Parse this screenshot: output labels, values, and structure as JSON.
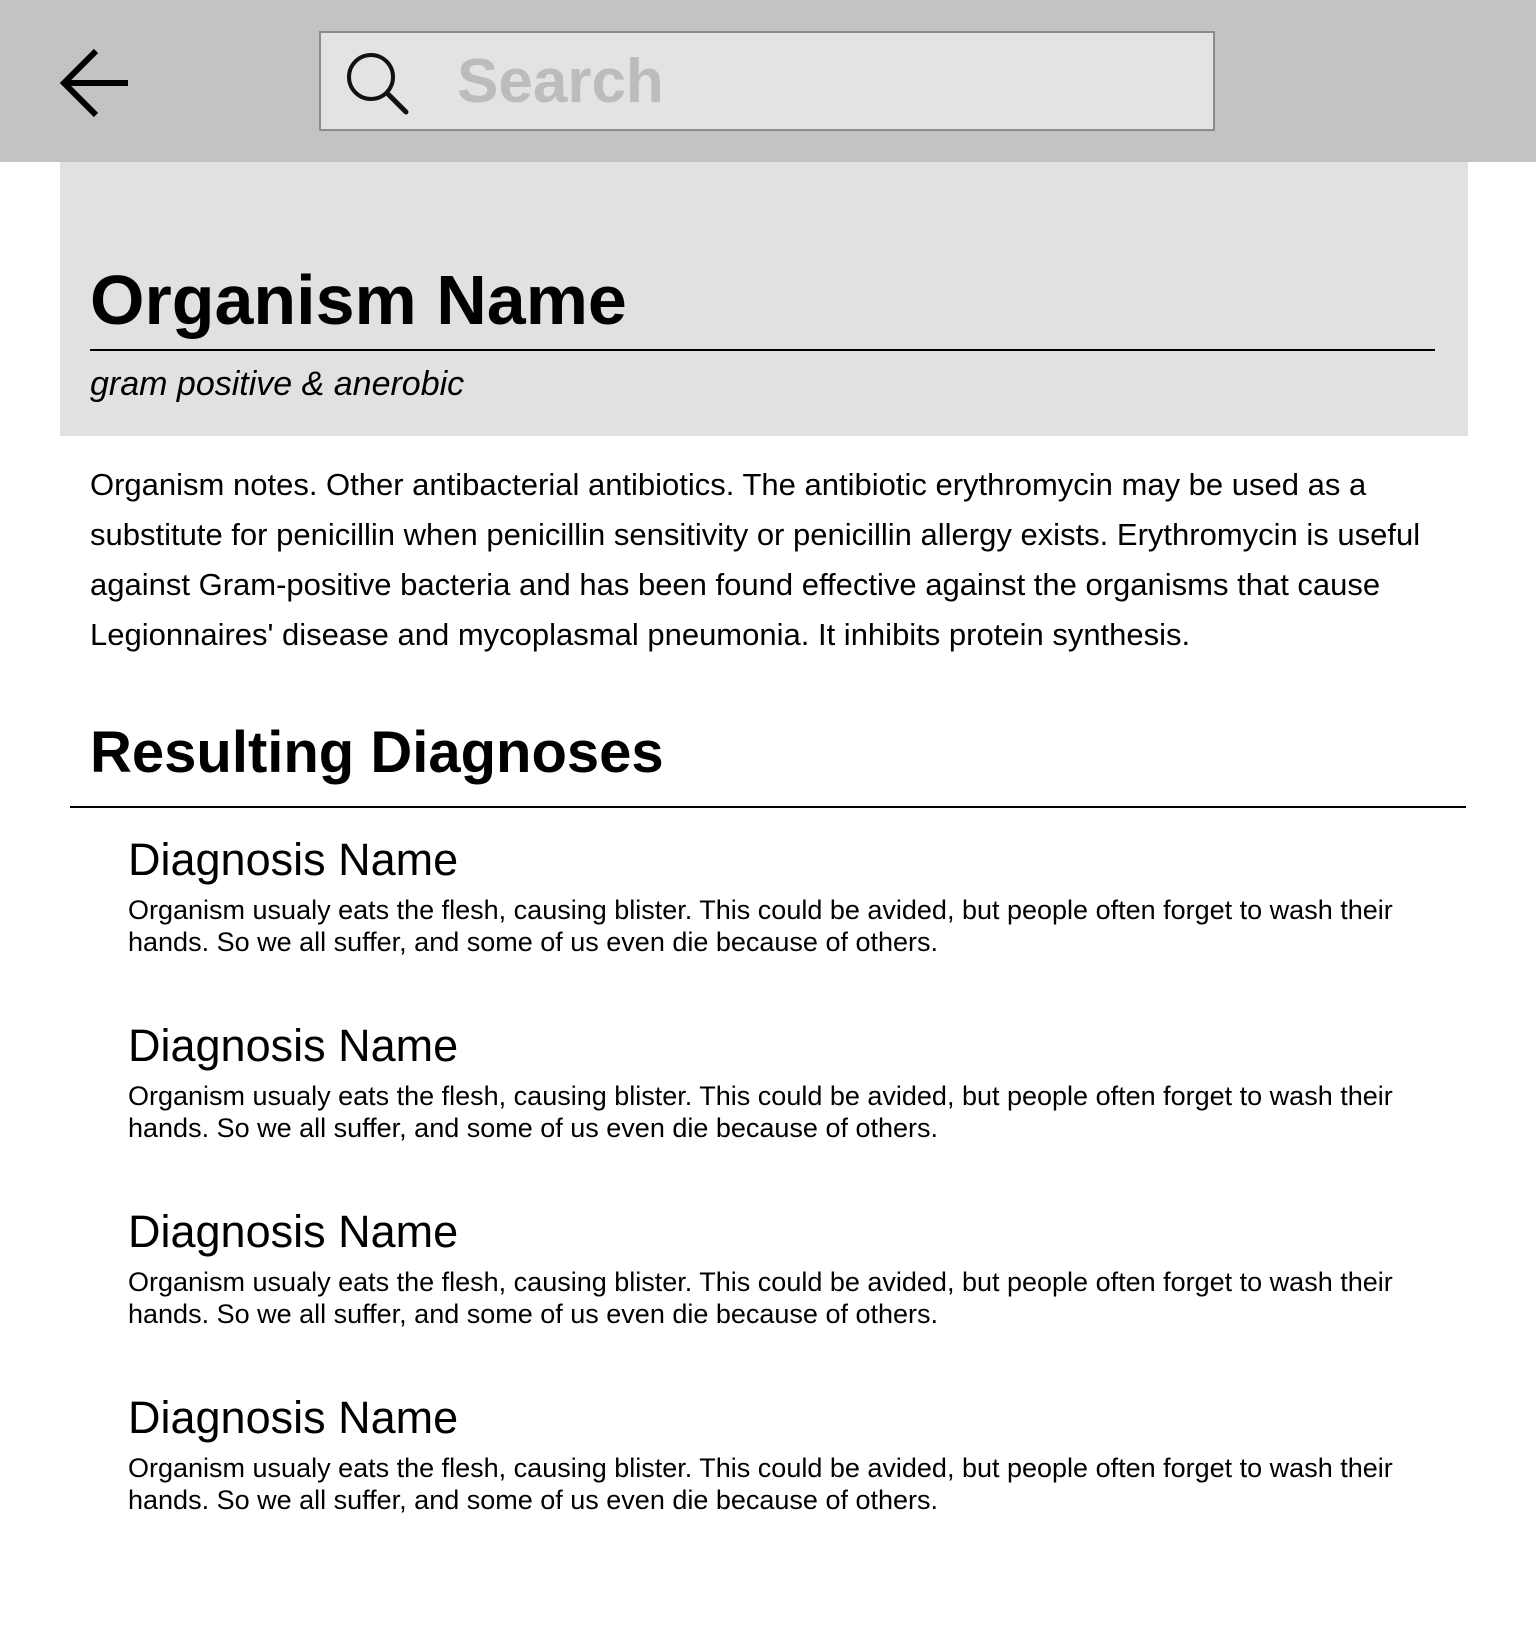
{
  "header": {
    "search_placeholder": "Search"
  },
  "organism": {
    "name": "Organism Name",
    "classification": "gram positive & anerobic",
    "notes": "Organism notes. Other antibacterial antibiotics. The antibiotic erythromycin may be used as a substitute for penicillin when penicillin sensitivity or penicillin allergy exists. Erythromycin is useful against Gram-positive bacteria and has been found effective against the organisms that cause Legionnaires' disease and mycoplasmal pneumonia. It inhibits protein synthesis."
  },
  "diagnoses": {
    "section_title": "Resulting Diagnoses",
    "items": [
      {
        "name": "Diagnosis Name",
        "description": "Organism usualy eats the flesh, causing blister. This could be avided, but people often forget to wash their hands. So we all suffer, and some of us even die because of others."
      },
      {
        "name": "Diagnosis Name",
        "description": "Organism usualy eats the flesh, causing blister. This could be avided, but people often forget to wash their hands. So we all suffer, and some of us even die because of others."
      },
      {
        "name": "Diagnosis Name",
        "description": "Organism usualy eats the flesh, causing blister. This could be avided, but people often forget to wash their hands. So we all suffer, and some of us even die because of others."
      },
      {
        "name": "Diagnosis Name",
        "description": "Organism usualy eats the flesh, causing blister. This could be avided, but people often forget to wash their hands. So we all suffer, and some of us even die because of others."
      }
    ]
  },
  "colors": {
    "topbar": "#c3c3c3",
    "search_field": "#e3e3e3",
    "header_panel": "#e1e1e1"
  },
  "icons": {
    "back": "arrow-left-icon",
    "search": "search-icon"
  }
}
